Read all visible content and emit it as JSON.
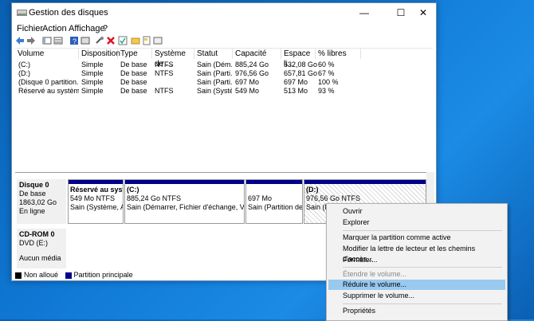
{
  "window": {
    "title": "Gestion des disques"
  },
  "menu": [
    "Fichier",
    "Action",
    "Affichage",
    "?"
  ],
  "table": {
    "columns": [
      "Volume",
      "Disposition",
      "Type",
      "Système de ...",
      "Statut",
      "Capacité",
      "Espace li...",
      "% libres"
    ],
    "rows": [
      [
        "(C:)",
        "Simple",
        "De base",
        "NTFS",
        "Sain (Dém...",
        "885,24 Go",
        "532,08 Go",
        "60 %"
      ],
      [
        "(D:)",
        "Simple",
        "De base",
        "NTFS",
        "Sain (Parti...",
        "976,56 Go",
        "657,81 Go",
        "67 %"
      ],
      [
        "(Disque 0 partition...",
        "Simple",
        "De base",
        "",
        "Sain (Parti...",
        "697 Mo",
        "697 Mo",
        "100 %"
      ],
      [
        "Réservé au système",
        "Simple",
        "De base",
        "NTFS",
        "Sain (Systè...",
        "549 Mo",
        "513 Mo",
        "93 %"
      ]
    ]
  },
  "disk0": {
    "name": "Disque 0",
    "type": "De base",
    "size": "1863,02 Go",
    "status": "En ligne",
    "partitions": [
      {
        "title": "Réservé au systè",
        "size": "549 Mo NTFS",
        "status": "Sain (Système, Act"
      },
      {
        "title": "(C:)",
        "size": "885,24 Go NTFS",
        "status": "Sain (Démarrer, Fichier d'échange, Vidage s"
      },
      {
        "title": "",
        "size": "697 Mo",
        "status": "Sain (Partition de ré"
      },
      {
        "title": "(D:)",
        "size": "976,56 Go NTFS",
        "status": "Sain (Pa"
      }
    ]
  },
  "cdrom": {
    "name": "CD-ROM 0",
    "drive": "DVD (E:)",
    "status": "Aucun média"
  },
  "legend": {
    "unallocated": "Non alloué",
    "primary": "Partition principale"
  },
  "context_menu": {
    "items": [
      {
        "label": "Ouvrir",
        "enabled": true
      },
      {
        "label": "Explorer",
        "enabled": true
      },
      {
        "label": "Marquer la partition comme active",
        "enabled": true
      },
      {
        "label": "Modifier la lettre de lecteur et les chemins d'accès...",
        "enabled": true
      },
      {
        "label": "Formater...",
        "enabled": true
      },
      {
        "label": "Étendre le volume...",
        "enabled": false
      },
      {
        "label": "Réduire le volume...",
        "enabled": true,
        "highlighted": true
      },
      {
        "label": "Supprimer le volume...",
        "enabled": true
      },
      {
        "label": "Propriétés",
        "enabled": true
      }
    ]
  },
  "colors": {
    "primary_partition": "#00008b",
    "highlight": "#99c9ef",
    "desktop": "#0f78d4"
  }
}
